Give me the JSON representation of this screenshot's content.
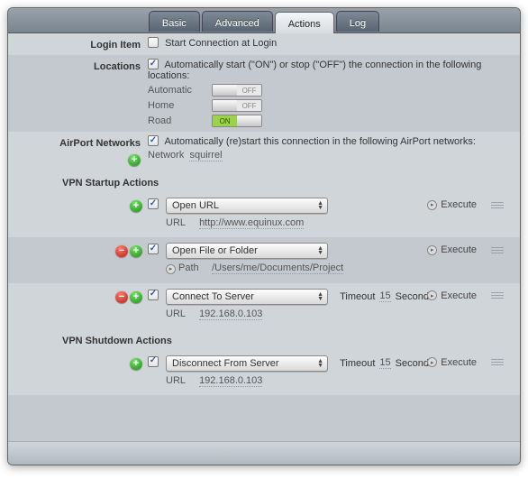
{
  "tabs": [
    "Basic",
    "Advanced",
    "Actions",
    "Log"
  ],
  "active_tab": 2,
  "login_item": {
    "heading": "Login Item",
    "checked": false,
    "label": "Start Connection at Login"
  },
  "locations": {
    "heading": "Locations",
    "checked": true,
    "label": "Automatically start (\"ON\") or stop (\"OFF\") the connection in the following locations:",
    "rows": [
      {
        "name": "Automatic",
        "state": "OFF"
      },
      {
        "name": "Home",
        "state": "OFF"
      },
      {
        "name": "Road",
        "state": "ON"
      }
    ]
  },
  "airport": {
    "heading": "AirPort Networks",
    "checked": true,
    "label": "Automatically (re)start this connection in the following AirPort networks:",
    "network_key": "Network",
    "network_val": "squirrel"
  },
  "startup_heading": "VPN Startup Actions",
  "shutdown_heading": "VPN Shutdown Actions",
  "execute_label": "Execute",
  "timeout_label": "Timeout",
  "seconds_label": "Seconds",
  "actions_startup": [
    {
      "checked": true,
      "has_remove": false,
      "type": "Open URL",
      "detail_key": "URL",
      "detail_val": "http://www.equinux.com",
      "timeout": null
    },
    {
      "checked": true,
      "has_remove": true,
      "type": "Open File or Folder",
      "detail_key": "Path",
      "detail_val": "/Users/me/Documents/Project",
      "path_has_icon": true,
      "timeout": null
    },
    {
      "checked": true,
      "has_remove": true,
      "type": "Connect To Server",
      "detail_key": "URL",
      "detail_val": "192.168.0.103",
      "timeout": "15"
    }
  ],
  "actions_shutdown": [
    {
      "checked": true,
      "has_remove": false,
      "type": "Disconnect From Server",
      "detail_key": "URL",
      "detail_val": "192.168.0.103",
      "timeout": "15"
    }
  ]
}
